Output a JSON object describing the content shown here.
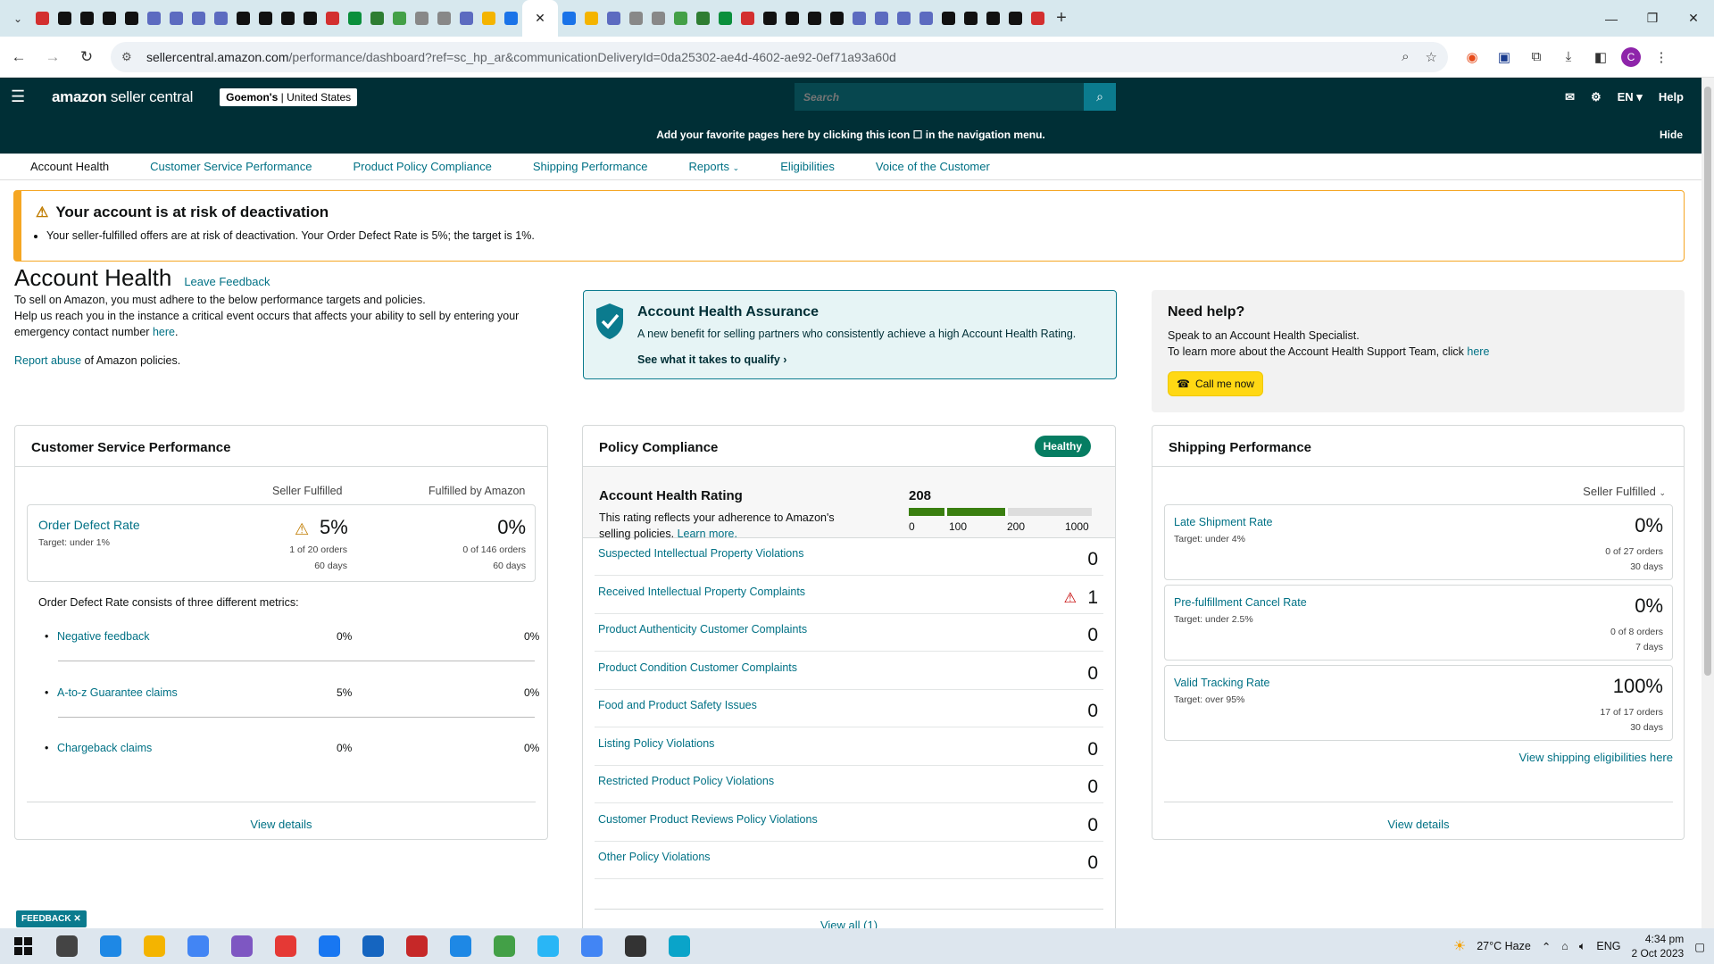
{
  "browser": {
    "url_host": "sellercentral.amazon.com",
    "url_path": "/performance/dashboard?ref=sc_hp_ar&communicationDeliveryId=0da25302-ae4d-4602-ae92-0ef71a93a60d",
    "profile_initial": "C",
    "tab_colors": [
      "#d32f2f",
      "#111",
      "#111",
      "#111",
      "#111",
      "#5c6bc0",
      "#5c6bc0",
      "#5c6bc0",
      "#5c6bc0",
      "#111",
      "#111",
      "#111",
      "#111",
      "#d32f2f",
      "#0a8f3c",
      "#2e7d32",
      "#43a047",
      "#888",
      "#888",
      "#5c6bc0",
      "#f4b400",
      "#1a73e8"
    ]
  },
  "header": {
    "logo_bold": "amazon",
    "logo_light": " seller central",
    "account_name": "Goemon's",
    "account_region": " | United States",
    "search_placeholder": "Search",
    "lang": "EN",
    "help": "Help"
  },
  "favbar": {
    "text": "Add your favorite pages here by clicking this icon ☐ in the navigation menu.",
    "hide": "Hide"
  },
  "subnav": [
    "Account Health",
    "Customer Service Performance",
    "Product Policy Compliance",
    "Shipping Performance",
    "Reports",
    "Eligibilities",
    "Voice of the Customer"
  ],
  "alert": {
    "title": "Your account is at risk of deactivation",
    "body": "Your seller-fulfilled offers are at risk of deactivation. Your Order Defect Rate is 5%; the target is 1%."
  },
  "intro": {
    "title": "Account Health",
    "leave_feedback": "Leave Feedback",
    "line1": "To sell on Amazon, you must adhere to the below performance targets and policies.",
    "line2": "Help us reach you in the instance a critical event occurs that affects your ability to sell by entering your emergency contact number",
    "here": "here",
    "report_abuse": "Report abuse",
    "abuse_rest": " of Amazon policies."
  },
  "assurance": {
    "title": "Account Health Assurance",
    "text": "A new benefit for selling partners who consistently achieve a high Account Health Rating.",
    "link": "See what it takes to qualify ›"
  },
  "needhelp": {
    "title": "Need help?",
    "line1": "Speak to an Account Health Specialist.",
    "line2": "To learn more about the Account Health Support Team, click",
    "here": "here",
    "button": "Call me now"
  },
  "csp": {
    "title": "Customer Service Performance",
    "col_seller": "Seller Fulfilled",
    "col_fba": "Fulfilled by Amazon",
    "odr_name": "Order Defect Rate",
    "odr_target": "Target: under 1%",
    "seller_value": "5%",
    "seller_orders": "1 of 20 orders",
    "seller_days": "60 days",
    "fba_value": "0%",
    "fba_orders": "0 of 146 orders",
    "fba_days": "60 days",
    "intro": "Order Defect Rate consists of three different metrics:",
    "metrics": [
      {
        "name": "Negative feedback",
        "seller": "0%",
        "fba": "0%"
      },
      {
        "name": "A-to-z Guarantee claims",
        "seller": "5%",
        "fba": "0%"
      },
      {
        "name": "Chargeback claims",
        "seller": "0%",
        "fba": "0%"
      }
    ],
    "view_details": "View details"
  },
  "policy": {
    "title": "Policy Compliance",
    "badge": "Healthy",
    "rating_title": "Account Health Rating",
    "rating_text": "This rating reflects your adherence to Amazon's selling policies.",
    "learn_more": "Learn more.",
    "score": "208",
    "score_value": 208,
    "scale_ticks": [
      "0",
      "100",
      "200",
      "1000"
    ],
    "rows": [
      {
        "name": "Suspected Intellectual Property Violations",
        "count": "0",
        "warn": false
      },
      {
        "name": "Received Intellectual Property Complaints",
        "count": "1",
        "warn": true
      },
      {
        "name": "Product Authenticity Customer Complaints",
        "count": "0",
        "warn": false
      },
      {
        "name": "Product Condition Customer Complaints",
        "count": "0",
        "warn": false
      },
      {
        "name": "Food and Product Safety Issues",
        "count": "0",
        "warn": false
      },
      {
        "name": "Listing Policy Violations",
        "count": "0",
        "warn": false
      },
      {
        "name": "Restricted Product Policy Violations",
        "count": "0",
        "warn": false
      },
      {
        "name": "Customer Product Reviews Policy Violations",
        "count": "0",
        "warn": false
      },
      {
        "name": "Other Policy Violations",
        "count": "0",
        "warn": false
      }
    ],
    "view_all": "View all (1)"
  },
  "shipping": {
    "title": "Shipping Performance",
    "dropdown": "Seller Fulfilled",
    "metrics": [
      {
        "name": "Late Shipment Rate",
        "target": "Target: under 4%",
        "value": "0%",
        "orders": "0 of 27 orders",
        "days": "30 days"
      },
      {
        "name": "Pre-fulfillment Cancel Rate",
        "target": "Target: under 2.5%",
        "value": "0%",
        "orders": "0 of 8 orders",
        "days": "7 days"
      },
      {
        "name": "Valid Tracking Rate",
        "target": "Target: over 95%",
        "value": "100%",
        "orders": "17 of 17 orders",
        "days": "30 days"
      }
    ],
    "eligibilities": "View shipping eligibilities here",
    "view_details": "View details"
  },
  "feedback_tab": "FEEDBACK ✕",
  "taskbar": {
    "weather": "27°C  Haze",
    "lang": "ENG",
    "time": "4:34 pm",
    "date": "2 Oct 2023",
    "app_colors": [
      "#444",
      "#1e88e5",
      "#f4b400",
      "#4285f4",
      "#7e57c2",
      "#e53935",
      "#1877f2",
      "#1565c0",
      "#c62828",
      "#1e88e5",
      "#43a047",
      "#29b6f6",
      "#4285f4",
      "#333",
      "#0aa4c9"
    ]
  }
}
